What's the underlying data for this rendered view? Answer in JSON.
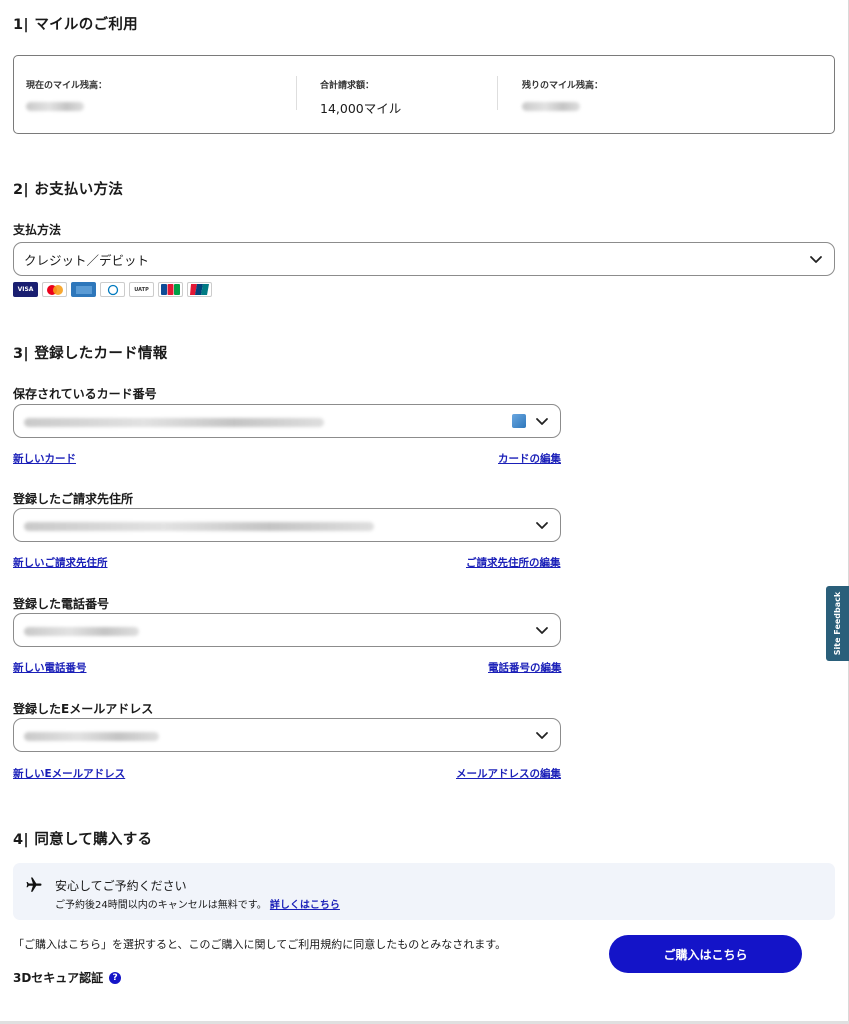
{
  "sections": {
    "miles": {
      "title": "1| マイルのご利用",
      "current_label": "現在のマイル残高：",
      "total_label": "合計請求額：",
      "total_value": "14,000マイル",
      "remaining_label": "残りのマイル残高："
    },
    "payment": {
      "title": "2| お支払い方法",
      "method_label": "支払方法",
      "method_value": "クレジット／デビット",
      "card_brands": [
        "VISA",
        "MC",
        "AMEX",
        "DINERS",
        "UATP",
        "JCB",
        "UNIONPAY"
      ]
    },
    "cards": {
      "title": "3| 登録したカード情報",
      "card_label": "保存されているカード番号",
      "new_card": "新しいカード",
      "edit_card": "カードの編集",
      "address_label": "登録したご請求先住所",
      "new_address": "新しいご請求先住所",
      "edit_address": "ご請求先住所の編集",
      "phone_label": "登録した電話番号",
      "new_phone": "新しい電話番号",
      "edit_phone": "電話番号の編集",
      "email_label": "登録したEメールアドレス",
      "new_email": "新しいEメールアドレス",
      "edit_email": "メールアドレスの編集"
    },
    "agree": {
      "title": "4| 同意して購入する",
      "info_title": "安心してご予約ください",
      "info_sub": "ご予約後24時間以内のキャンセルは無料です。",
      "info_link": "詳しくはこちら",
      "terms": "「ご購入はこちら」を選択すると、このご購入に関してご利用規約に同意したものとみなされます。",
      "buy_button": "ご購入はこちら",
      "secure_label": "3Dセキュア認証",
      "help_icon": "?"
    }
  },
  "feedback_tab": "Site Feedback",
  "colors": {
    "accent": "#1414c8",
    "link": "#1a1fb8",
    "info_bg": "#f1f4fa",
    "feedback_bg": "#2a5f7a"
  }
}
